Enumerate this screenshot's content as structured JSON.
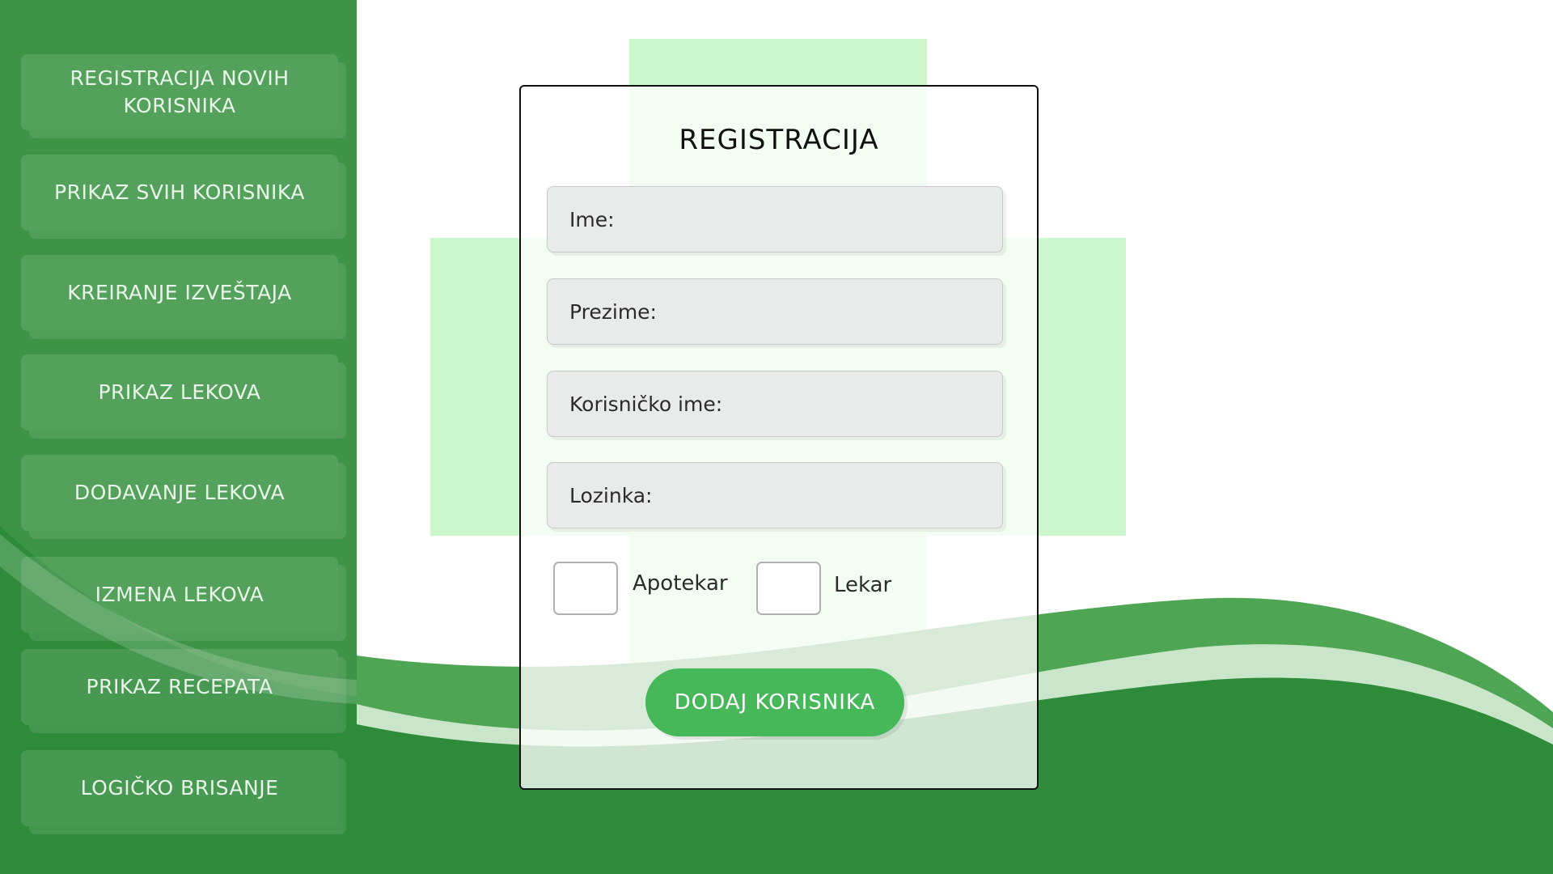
{
  "sidebar": {
    "items": [
      {
        "label": "REGISTRACIJA NOVIH KORISNIKA"
      },
      {
        "label": "PRIKAZ SVIH KORISNIKA"
      },
      {
        "label": "KREIRANJE IZVEŠTAJA"
      },
      {
        "label": "PRIKAZ LEKOVA"
      },
      {
        "label": "DODAVANJE LEKOVA"
      },
      {
        "label": "IZMENA LEKOVA"
      },
      {
        "label": "PRIKAZ RECEPATA"
      },
      {
        "label": "LOGIČKO BRISANJE"
      }
    ]
  },
  "form": {
    "title": "REGISTRACIJA",
    "fields": {
      "first_name": "Ime:",
      "last_name": "Prezime:",
      "username": "Korisničko ime:",
      "password": "Lozinka:"
    },
    "checkboxes": {
      "pharmacist": {
        "label": "Apotekar",
        "checked": false
      },
      "doctor": {
        "label": "Lekar",
        "checked": false
      }
    },
    "submit_label": "DODAJ KORISNIKA"
  },
  "background": {
    "decoration": "pharmacy-cross-icon",
    "colors": {
      "dark_green": "#2e8b3a",
      "mid_green": "#4ea553",
      "light_cross": "#ccf7cc",
      "button_green": "#47b85a"
    }
  }
}
